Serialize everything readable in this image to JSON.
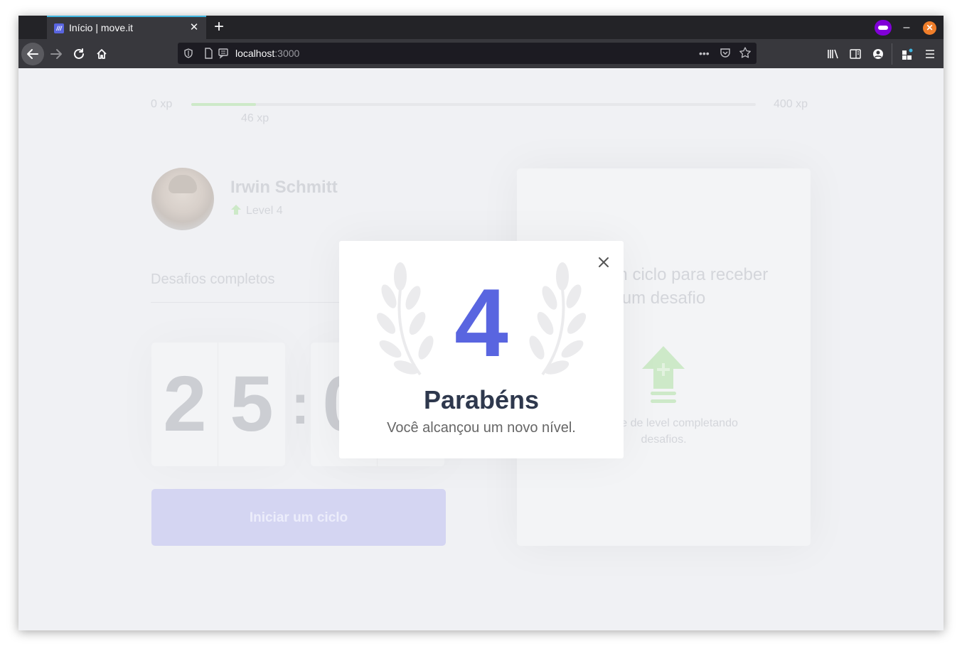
{
  "browser": {
    "tab_title": "Início | move.it",
    "tab_favicon_text": "///",
    "new_tab_label": "+",
    "url_host": "localhost",
    "url_port": ":3000",
    "icons": {
      "back": "back-arrow-icon",
      "forward": "forward-arrow-icon",
      "reload": "reload-icon",
      "home": "home-icon",
      "private": "private-browsing-icon",
      "library": "library-icon",
      "sidebar": "sidebar-icon",
      "account": "account-icon",
      "extensions": "extensions-icon",
      "menu": "hamburger-menu-icon"
    }
  },
  "experience": {
    "min_label": "0 xp",
    "max_label": "400 xp",
    "current_label": "46 xp",
    "current_fraction": 0.115
  },
  "profile": {
    "name": "Irwin Schmitt",
    "level_label": "Level 4"
  },
  "challenges": {
    "completed_label": "Desafios completos"
  },
  "countdown": {
    "minute_left": "2",
    "minute_right": "5",
    "separator": ":",
    "second_left": "0"
  },
  "start_button_label": "Iniciar um ciclo",
  "challenge_box": {
    "title": "Inicie um ciclo para receber um desafio",
    "description": "Avance de level completando desafios."
  },
  "level_up_modal": {
    "level": "4",
    "title": "Parabéns",
    "message": "Você alcançou um novo nível."
  },
  "colors": {
    "accent": "#5965e0",
    "title": "#2e384d",
    "green": "#4cd62b",
    "background": "#f0f1f4"
  }
}
